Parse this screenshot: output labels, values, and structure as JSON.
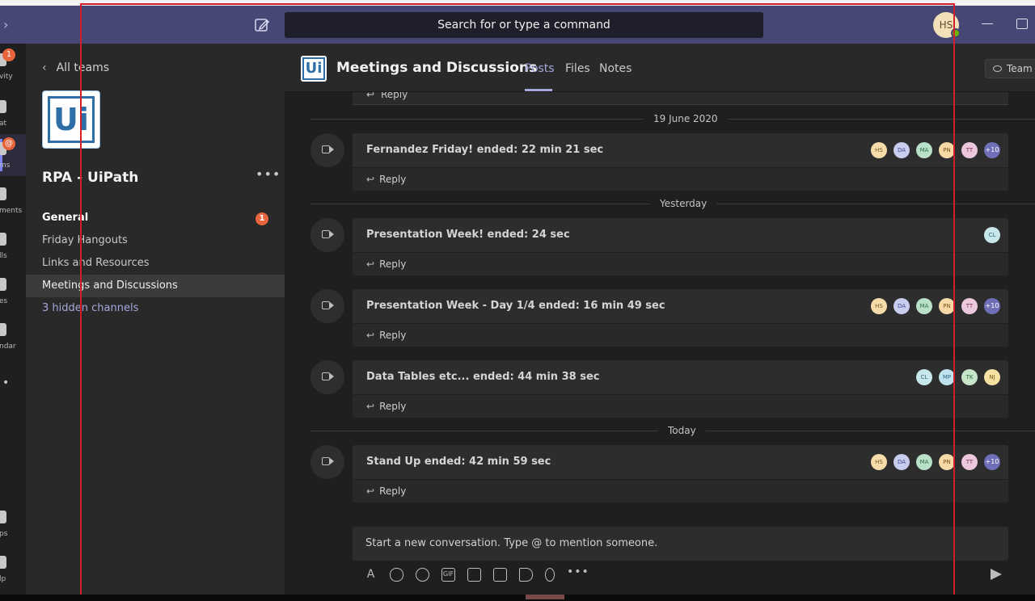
{
  "titlebar": {
    "search_placeholder": "Search for or type a command",
    "avatar_initials": "HS"
  },
  "rail": {
    "items": [
      {
        "label": "vity",
        "icon": "bell-icon",
        "badge": "1"
      },
      {
        "label": "at",
        "icon": "chat-icon",
        "badge": ""
      },
      {
        "label": "ms",
        "icon": "teams-icon",
        "badge": "@"
      },
      {
        "label": "ments",
        "icon": "assignments-icon",
        "badge": ""
      },
      {
        "label": "lls",
        "icon": "calls-icon",
        "badge": ""
      },
      {
        "label": "es",
        "icon": "files-icon",
        "badge": ""
      },
      {
        "label": "ndar",
        "icon": "calendar-icon",
        "badge": ""
      },
      {
        "label": "ps",
        "icon": "apps-icon",
        "badge": ""
      },
      {
        "label": "lp",
        "icon": "help-icon",
        "badge": ""
      }
    ]
  },
  "sidebar": {
    "back_label": "All teams",
    "team_logo_text": "Ui",
    "team_name": "RPA - UiPath",
    "channels": [
      {
        "label": "General",
        "badge": "1"
      },
      {
        "label": "Friday Hangouts"
      },
      {
        "label": "Links and Resources"
      },
      {
        "label": "Meetings and Discussions"
      },
      {
        "label": "3 hidden channels"
      }
    ]
  },
  "channel_header": {
    "logo_text": "Ui",
    "title": "Meetings and Discussions",
    "tabs": [
      "Posts",
      "Files",
      "Notes"
    ],
    "team_button": "Team"
  },
  "feed": {
    "reply_label": "Reply",
    "dividers": [
      "19 June 2020",
      "Yesterday",
      "Today"
    ],
    "messages": [
      {
        "title": "Fernandez Friday! ended: 22 min 21 sec",
        "avatars": [
          "HS",
          "DA",
          "MA",
          "PN",
          "TT",
          "+10"
        ]
      },
      {
        "title": "Presentation Week! ended: 24 sec",
        "avatars": [
          "CL"
        ]
      },
      {
        "title": "Presentation Week - Day 1/4 ended: 16 min 49 sec",
        "avatars": [
          "HS",
          "DA",
          "MA",
          "PN",
          "TT",
          "+10"
        ]
      },
      {
        "title": "Data Tables etc... ended: 44 min 38 sec",
        "avatars": [
          "CL",
          "MP",
          "TK",
          "NJ"
        ]
      },
      {
        "title": "Stand Up ended: 42 min 59 sec",
        "avatars": [
          "HS",
          "DA",
          "MA",
          "PN",
          "TT",
          "+10"
        ]
      }
    ]
  },
  "composer": {
    "placeholder": "Start a new conversation. Type @ to mention someone.",
    "tools": [
      "format-icon",
      "attach-icon",
      "emoji-icon",
      "gif-icon",
      "sticker-icon",
      "meet-icon",
      "stream-icon",
      "praise-icon",
      "more-icon"
    ]
  },
  "colors": {
    "titlebar": "#464775",
    "accent": "#a6a7dc",
    "badge": "#e8643c",
    "frame": "#d01f2b"
  }
}
